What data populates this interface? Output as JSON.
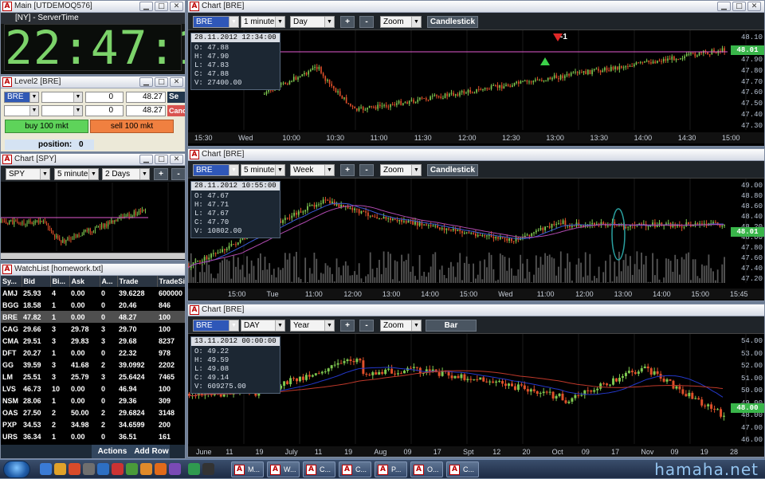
{
  "main": {
    "title": "Main [UTDEMOQ576]",
    "servertime_label": "[NY] - ServerTime",
    "clock": "22:47:19"
  },
  "level2": {
    "title": "Level2 [BRE]",
    "symbol": "BRE",
    "qty1": "0",
    "qty2": "0",
    "price1": "48.27",
    "price2": "48.27",
    "send_label": "Se",
    "cancel_label": "Canc",
    "buy_label": "buy 100 mkt",
    "sell_label": "sell 100 mkt",
    "position_label": "position:",
    "position_value": "0"
  },
  "small_chart": {
    "title": "Chart [SPY]",
    "symbol": "SPY",
    "interval": "5 minutes",
    "range": "2 Days",
    "zoom_in": "+",
    "zoom_out": "-"
  },
  "watchlist": {
    "title": "WatchList [homework.txt]",
    "headers": [
      "Sy...",
      "Bid",
      "Bi...",
      "Ask",
      "A...",
      "Trade",
      "TradeSiz"
    ],
    "rows": [
      [
        "AMJ",
        "25.93",
        "4",
        "0.00",
        "0",
        "39.6228",
        "600000"
      ],
      [
        "BGG",
        "18.58",
        "1",
        "0.00",
        "0",
        "20.46",
        "846"
      ],
      [
        "BRE",
        "47.82",
        "1",
        "0.00",
        "0",
        "48.27",
        "100"
      ],
      [
        "CAG",
        "29.66",
        "3",
        "29.78",
        "3",
        "29.70",
        "100"
      ],
      [
        "CMA",
        "29.51",
        "3",
        "29.83",
        "3",
        "29.68",
        "8237"
      ],
      [
        "DFT",
        "20.27",
        "1",
        "0.00",
        "0",
        "22.32",
        "978"
      ],
      [
        "GG",
        "39.59",
        "3",
        "41.68",
        "2",
        "39.0992",
        "2202"
      ],
      [
        "LM",
        "25.51",
        "3",
        "25.79",
        "3",
        "25.6424",
        "7465"
      ],
      [
        "LVS",
        "46.73",
        "10",
        "0.00",
        "0",
        "46.94",
        "100"
      ],
      [
        "NSM",
        "28.06",
        "1",
        "0.00",
        "0",
        "29.36",
        "309"
      ],
      [
        "OAS",
        "27.50",
        "2",
        "50.00",
        "2",
        "29.6824",
        "3148"
      ],
      [
        "PXP",
        "34.53",
        "2",
        "34.98",
        "2",
        "34.6599",
        "200"
      ],
      [
        "URS",
        "36.34",
        "1",
        "0.00",
        "0",
        "36.51",
        "161"
      ]
    ],
    "actions_label": "Actions",
    "addrow_label": "Add Row"
  },
  "chart1": {
    "title": "Chart [BRE]",
    "symbol": "BRE",
    "interval": "1 minute",
    "range": "Day",
    "zoom": "Zoom",
    "plus": "+",
    "minus": "-",
    "style": "Candlestick",
    "ohlc": {
      "date": "28.11.2012 12:34:00",
      "o": "O: 47.88",
      "h": "H: 47.90",
      "l": "L: 47.83",
      "c": "C: 47.88",
      "v": "V: 27400.00"
    },
    "yticks": [
      "48.10",
      "48.00",
      "47.90",
      "47.80",
      "47.70",
      "47.60",
      "47.50",
      "47.40",
      "47.30"
    ],
    "last": "48.01",
    "marker": "-1",
    "xticks": [
      "15:30",
      "Wed",
      "10:00",
      "10:30",
      "11:00",
      "11:30",
      "12:00",
      "12:30",
      "13:00",
      "13:30",
      "14:00",
      "14:30",
      "15:00"
    ]
  },
  "chart2": {
    "title": "Chart [BRE]",
    "symbol": "BRE",
    "interval": "5 minutes",
    "range": "Week",
    "zoom": "Zoom",
    "plus": "+",
    "minus": "-",
    "style": "Candlestick",
    "ohlc": {
      "date": "28.11.2012 10:55:00",
      "o": "O: 47.67",
      "h": "H: 47.71",
      "l": "L: 47.67",
      "c": "C: 47.70",
      "v": "V: 10802.00"
    },
    "yticks": [
      "49.00",
      "48.80",
      "48.60",
      "48.40",
      "48.20",
      "48.00",
      "47.80",
      "47.60",
      "47.40",
      "47.20"
    ],
    "last": "48.01",
    "xticks": [
      "15:00",
      "Tue",
      "11:00",
      "12:00",
      "13:00",
      "14:00",
      "15:00",
      "Wed",
      "11:00",
      "12:00",
      "13:00",
      "14:00",
      "15:00",
      "15:45"
    ]
  },
  "chart3": {
    "title": "Chart [BRE]",
    "symbol": "BRE",
    "interval": "DAY",
    "range": "Year",
    "zoom": "Zoom",
    "plus": "+",
    "minus": "-",
    "style": "Bar",
    "ohlc": {
      "date": "13.11.2012 00:00:00",
      "o": "O: 49.22",
      "h": "H: 49.59",
      "l": "L: 49.08",
      "c": "C: 49.14",
      "v": "V: 609275.00"
    },
    "yticks": [
      "54.00",
      "53.00",
      "52.00",
      "51.00",
      "50.00",
      "49.00",
      "48.00",
      "47.00",
      "46.00"
    ],
    "last": "48.00",
    "xticks": [
      "June",
      "11",
      "19",
      "July",
      "11",
      "19",
      "Aug",
      "09",
      "17",
      "Spt",
      "12",
      "20",
      "Oct",
      "09",
      "17",
      "Nov",
      "09",
      "19",
      "28"
    ]
  },
  "taskbar": {
    "items": [
      "M...",
      "W...",
      "C...",
      "C...",
      "P...",
      "O...",
      "C..."
    ],
    "watermark": "hamaha.net"
  }
}
